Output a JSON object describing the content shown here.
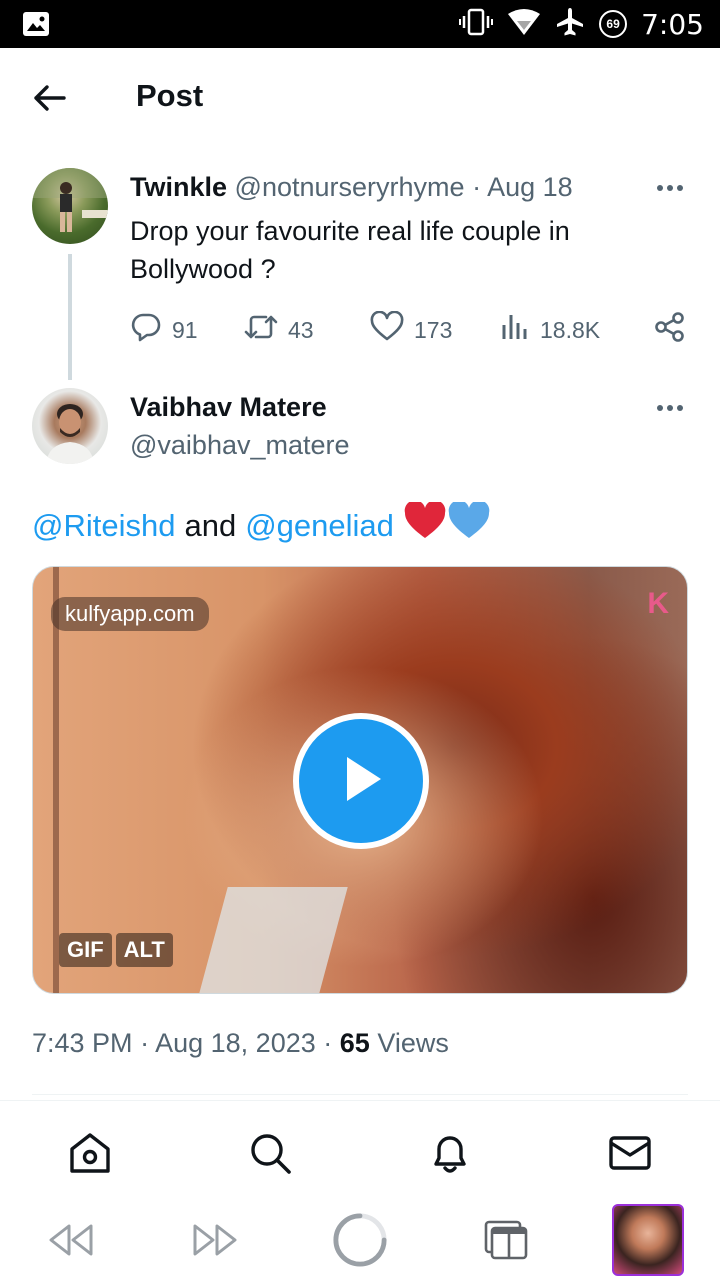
{
  "status_bar": {
    "time": "7:05",
    "battery_level": "69"
  },
  "header": {
    "title": "Post"
  },
  "original_tweet": {
    "name": "Twinkle",
    "handle": "@notnurseryrhyme",
    "separator": "·",
    "date": "Aug 18",
    "text": "Drop your favourite real life couple in Bollywood ?",
    "replies": "91",
    "retweets": "43",
    "likes": "173",
    "views": "18.8K"
  },
  "reply_tweet": {
    "name": "Vaibhav Matere",
    "handle": "@vaibhav_matere",
    "mention1": "@Riteishd",
    "connector": "and",
    "mention2": "@geneliad",
    "media": {
      "watermark": "kulfyapp.com",
      "corner_badge": "K",
      "gif_label": "GIF",
      "alt_label": "ALT"
    },
    "time": "7:43 PM",
    "date": "Aug 18, 2023",
    "separator": "·",
    "views_count": "65",
    "views_label": "Views"
  },
  "colors": {
    "accent": "#1d9bf0",
    "secondary_text": "#536471",
    "heart_red": "#e0263a",
    "heart_blue": "#5aa8e8"
  }
}
